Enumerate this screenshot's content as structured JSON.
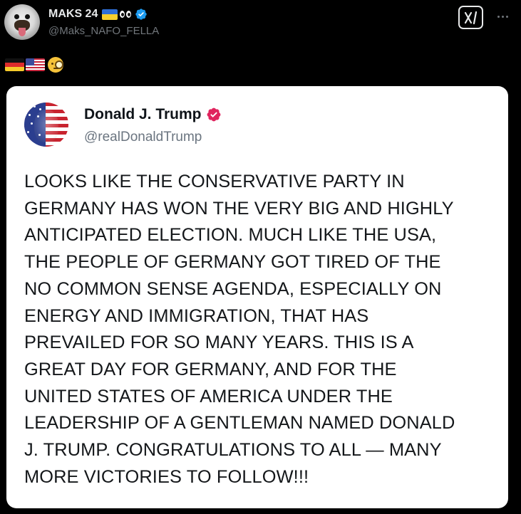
{
  "post": {
    "author": {
      "display_name": "MAKS 24",
      "handle": "@Maks_NAFO_FELLA",
      "avatar_icon": "dog-avatar",
      "verified": true,
      "name_emojis": [
        "ukraine-flag-emoji",
        "eyes-emoji"
      ]
    },
    "header_actions": {
      "grok_icon": "grok-icon",
      "more_icon": "more-options-icon"
    },
    "emoji_line": [
      "germany-flag-emoji",
      "usa-flag-emoji",
      "monocle-face-emoji"
    ]
  },
  "quoted_post_image": {
    "author_name": "Donald J. Trump",
    "author_handle": "@realDonaldTrump",
    "verified_badge_color": "#e0245e",
    "text": "LOOKS LIKE THE CONSERVATIVE PARTY IN\nGERMANY HAS WON THE VERY BIG AND HIGHLY\nANTICIPATED ELECTION. MUCH LIKE THE USA,\nTHE PEOPLE OF GERMANY GOT TIRED OF THE\nNO COMMON SENSE AGENDA, ESPECIALLY ON\nENERGY AND IMMIGRATION, THAT HAS\nPREVAILED FOR SO MANY YEARS. THIS IS A\nGREAT DAY FOR GERMANY, AND FOR THE\nUNITED STATES OF AMERICA UNDER THE\nLEADERSHIP OF A GENTLEMAN NAMED DONALD\nJ. TRUMP. CONGRATULATIONS TO ALL — MANY\nMORE VICTORIES TO FOLLOW!!!"
  },
  "colors": {
    "background": "#000000",
    "primary_text": "#e7e9ea",
    "secondary_text": "#71767b",
    "verified_blue": "#1d9bf0",
    "card_background": "#ffffff"
  }
}
